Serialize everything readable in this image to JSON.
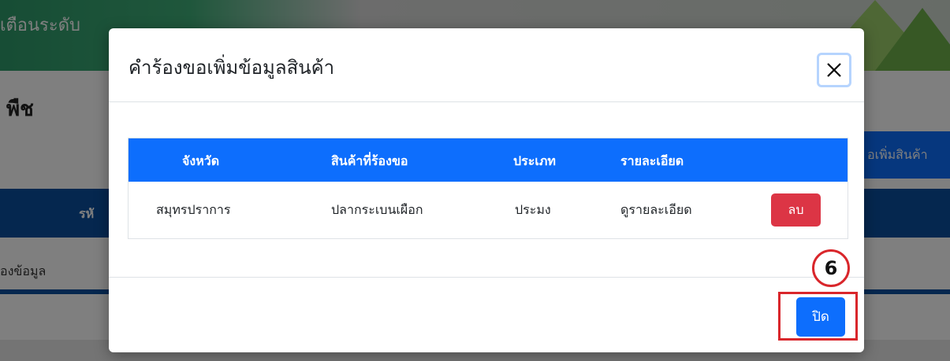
{
  "background": {
    "banner_text": "เตือนระดับ",
    "heading": "พืช",
    "add_button_label": "อเพิ่มสินค้า",
    "table_header_fragment": "รหั",
    "row_fragment": "องข้อมูล"
  },
  "modal": {
    "title": "คำร้องขอเพิ่มข้อมูลสินค้า",
    "close_icon": "close-icon",
    "table": {
      "headers": [
        "จังหวัด",
        "สินค้าที่ร้องขอ",
        "ประเภท",
        "รายละเอียด"
      ],
      "rows": [
        {
          "province": "สมุทรปราการ",
          "product": "ปลากระเบนเผือก",
          "type": "ประมง",
          "details_link": "ดูรายละเอียด",
          "delete_label": "ลบ"
        }
      ]
    },
    "footer": {
      "close_label": "ปิด"
    }
  },
  "annotation": {
    "step_number": "6"
  },
  "colors": {
    "primary": "#0d6efd",
    "danger": "#dc3545",
    "annotation_red": "#d9262b",
    "navy": "#0b4f9e"
  }
}
